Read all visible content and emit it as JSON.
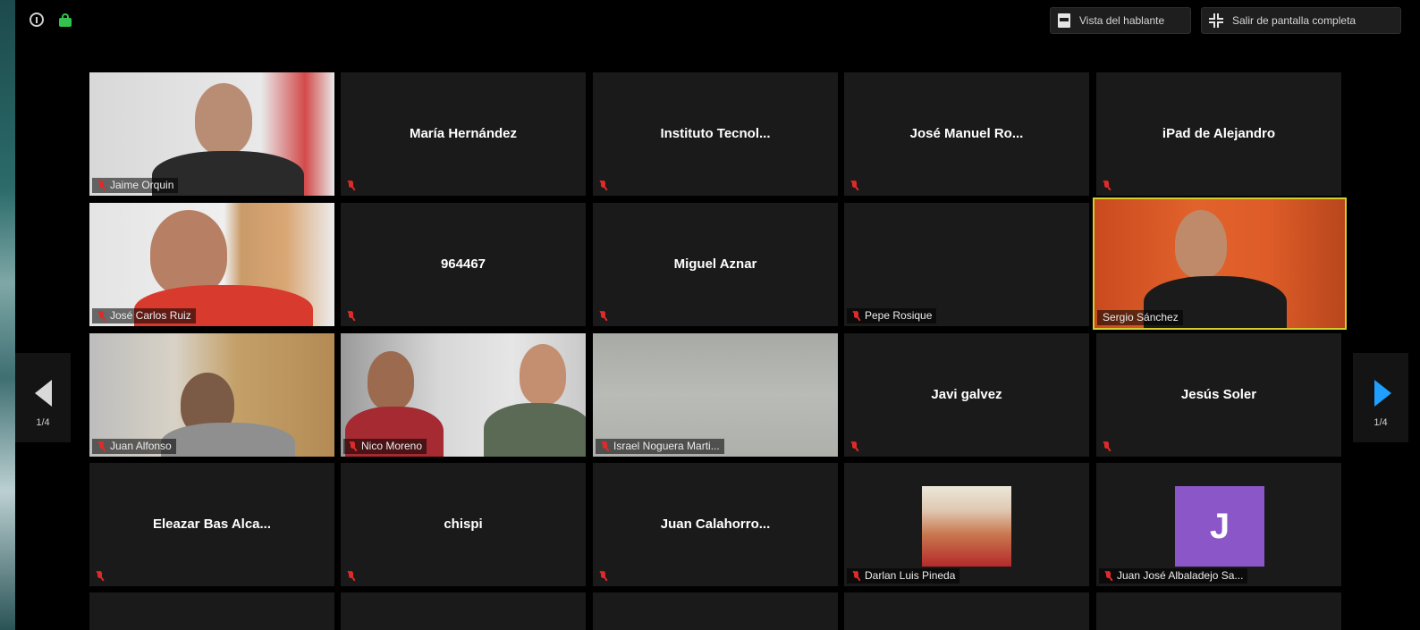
{
  "toolbar": {
    "speaker_view_label": "Vista del hablante",
    "exit_fullscreen_label": "Salir de pantalla completa"
  },
  "pagination": {
    "left": "1/4",
    "right": "1/4"
  },
  "participants": [
    {
      "name": "Jaime Orquin",
      "video": true
    },
    {
      "name": "María Hernández",
      "video": false
    },
    {
      "name": "Instituto Tecnol...",
      "video": false
    },
    {
      "name": "José Manuel Ro...",
      "video": false
    },
    {
      "name": "iPad de Alejandro",
      "video": false
    },
    {
      "name": "José Carlos Ruiz",
      "video": true
    },
    {
      "name": "964467",
      "video": false
    },
    {
      "name": "Miguel Aznar",
      "video": false
    },
    {
      "name": "Pepe Rosique",
      "video": false
    },
    {
      "name": "Sergio Sánchez",
      "video": true,
      "active_speaker": true
    },
    {
      "name": "Juan Alfonso",
      "video": true
    },
    {
      "name": "Nico Moreno",
      "video": true
    },
    {
      "name": "Israel Noguera Marti...",
      "video": true
    },
    {
      "name": "Javi galvez",
      "video": false
    },
    {
      "name": "Jesús Soler",
      "video": false
    },
    {
      "name": "Eleazar Bas Alca...",
      "video": false
    },
    {
      "name": "chispi",
      "video": false
    },
    {
      "name": "Juan Calahorro...",
      "video": false
    },
    {
      "name": "Darlan Luis Pineda",
      "video": false,
      "avatar": "photo"
    },
    {
      "name": "Juan José Albaladejo Sa...",
      "video": false,
      "avatar": "letter",
      "avatar_letter": "J",
      "avatar_color": "#8a56c8"
    }
  ],
  "colors": {
    "active_speaker_border": "#d2ce30",
    "muted_icon": "#e02a2a",
    "secure_lock": "#33c24d",
    "next_page_arrow": "#1fa0ff"
  }
}
